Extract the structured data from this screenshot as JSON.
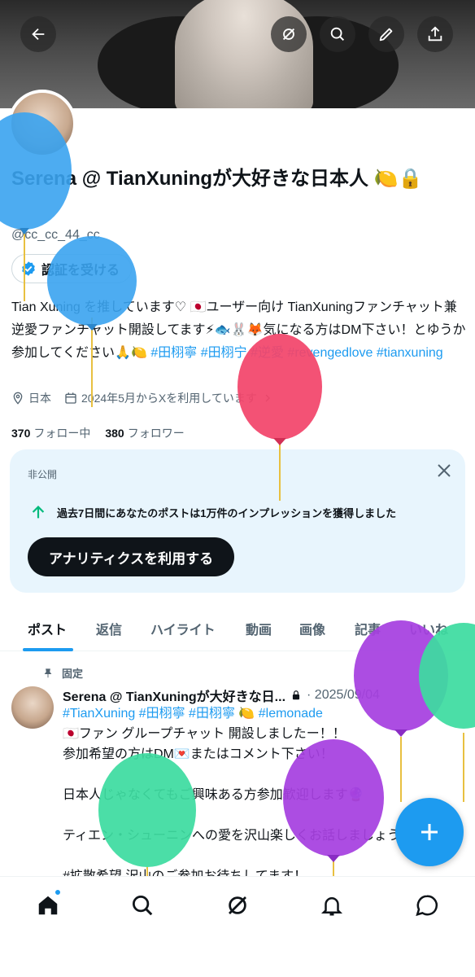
{
  "header": {
    "back_icon": "arrow-left-icon",
    "actions": [
      "grok-icon",
      "search-icon",
      "edit-icon",
      "share-icon"
    ]
  },
  "profile": {
    "display_name": "Serena @ TianXuningが大好きな日本人 🍋🔒",
    "handle": "@cc_cc_44_cc",
    "verify_button": "認証を受ける",
    "bio_text": "Tian Xuning を推しています♡ 🇯🇵ユーザー向け TianXuningファンチャット兼逆愛ファンチャット開設してます⚡🐟🐰🦊気になる方はDM下さい！とゆうか参加してください🙏🍋",
    "bio_hashtags": [
      "#田栩寧",
      "#田栩宁",
      "#逆愛",
      "#revengedlove",
      "#tianxuning"
    ],
    "location": "日本",
    "joined": "2024年5月からXを利用しています",
    "following_count": "370",
    "following_label": "フォロー中",
    "followers_count": "380",
    "followers_label": "フォロワー"
  },
  "private_card": {
    "label": "非公開",
    "message": "過去7日間にあなたのポストは1万件のインプレッションを獲得しました",
    "button": "アナリティクスを利用する"
  },
  "tabs": [
    "ポスト",
    "返信",
    "ハイライト",
    "動画",
    "画像",
    "記事",
    "いいね"
  ],
  "active_tab": "ポスト",
  "pinned_post": {
    "pin_label": "固定",
    "author": "Serena @ TianXuningが大好きな日...",
    "date": "· 2025/09/04",
    "hashtags_line": "#TianXuning #田栩寧 #田栩寧 🍋 #lemonade",
    "lines": [
      "🇯🇵ファン グループチャット 開設しましたー！！",
      "参加希望の方はDM💌またはコメント下さい！",
      "",
      "日本人じゃなくてもご興味ある方参加歓迎します🔮",
      "",
      "ティエン・シューニンへの愛を沢山楽しくお話しましょう",
      "",
      "#拡散希望 沢山のご参加お待ちしてます！"
    ]
  },
  "bottom_nav": [
    "home-icon",
    "search-icon",
    "grok-icon",
    "notifications-icon",
    "messages-icon"
  ],
  "colors": {
    "accent": "#1d9bf0",
    "balloon_blue": "#3aa3ef",
    "balloon_pink": "#f2456a",
    "balloon_purple": "#a640e0",
    "balloon_green": "#3ddca0"
  }
}
